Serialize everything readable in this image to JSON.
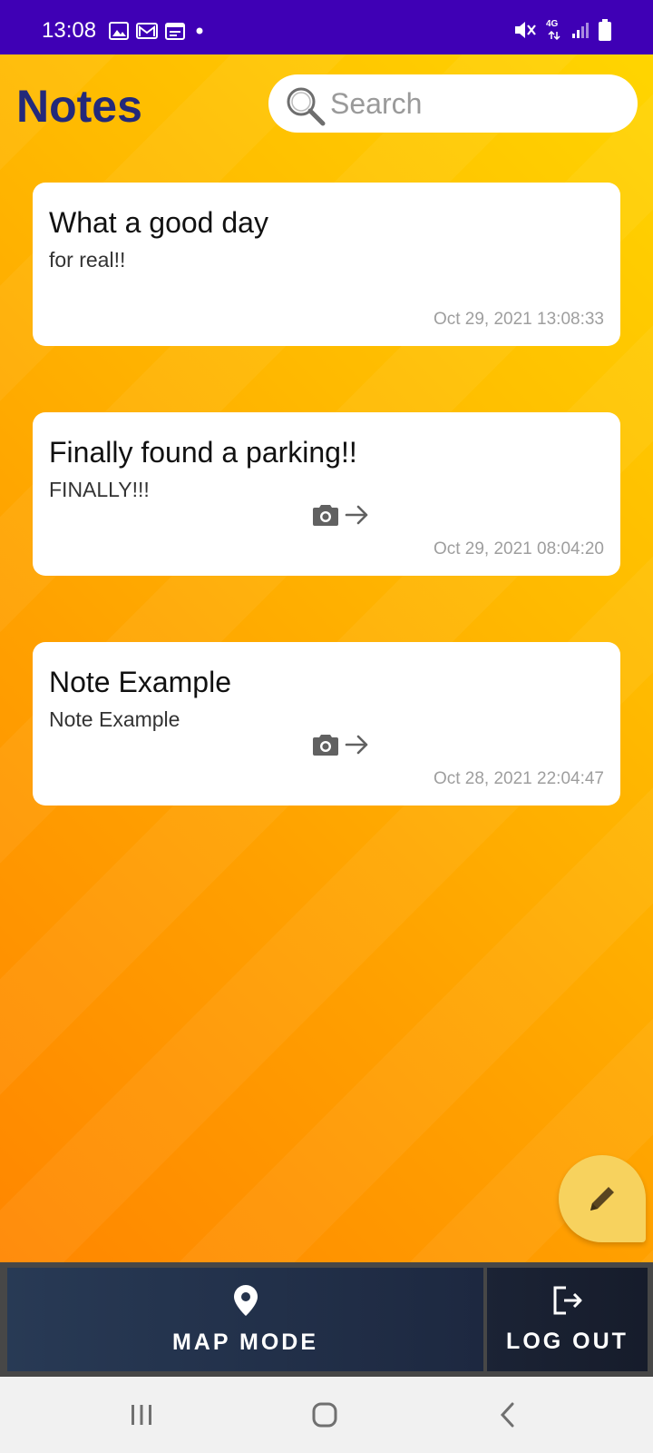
{
  "status_bar": {
    "time": "13:08",
    "network": "4G"
  },
  "header": {
    "title": "Notes",
    "search_placeholder": "Search"
  },
  "notes": [
    {
      "title": "What a good day",
      "body": "for real!!",
      "date": "Oct 29, 2021 13:08:33",
      "has_photo": false
    },
    {
      "title": "Finally found a parking!!",
      "body": "FINALLY!!!",
      "date": "Oct 29, 2021 08:04:20",
      "has_photo": true
    },
    {
      "title": "Note Example",
      "body": "Note Example",
      "date": "Oct 28, 2021 22:04:47",
      "has_photo": true
    }
  ],
  "bottom_bar": {
    "map_label": "MAP MODE",
    "logout_label": "LOG OUT"
  },
  "colors": {
    "status_bar": "#3f00b5",
    "title": "#23297a",
    "fab": "#f7d25e",
    "bottom_button": "#1d2840"
  },
  "icons": {
    "fab": "pencil-icon",
    "map": "map-pin-icon",
    "logout": "logout-icon",
    "search": "magnifier-icon",
    "attachment": "camera-icon"
  }
}
